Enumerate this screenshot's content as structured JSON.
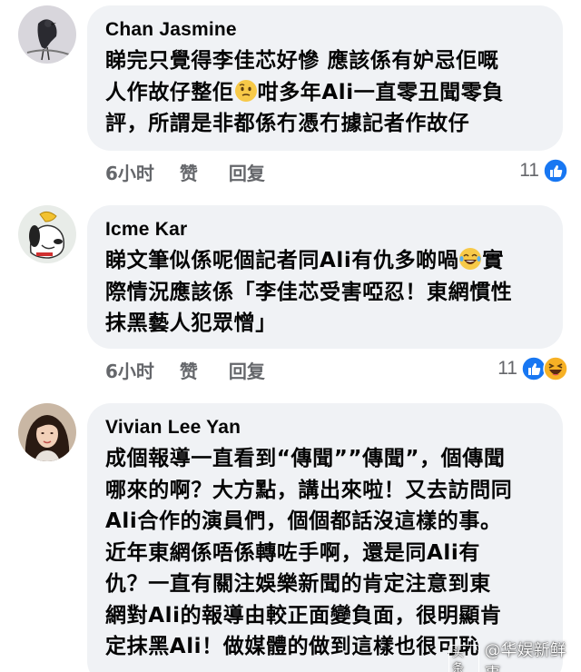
{
  "comments": [
    {
      "author": "Chan Jasmine",
      "lines": [
        "睇完只覺得李佳芯好慘 應該係有妒忌佢嘅",
        "人作故仔整佢",
        "咁多年Ali一直零丑聞零負",
        "評，所謂是非都係冇憑冇據記者作故仔"
      ],
      "time": "6小时",
      "like_label": "赞",
      "reply_label": "回复",
      "reaction_count": "11",
      "avatar": "bird-avatar"
    },
    {
      "author": "Icme Kar",
      "lines": [
        "睇文筆似係呢個記者同Ali有仇多啲喎",
        "實",
        "際情況應該係「李佳芯受害啞忍！東網慣性",
        "抹黑藝人犯眾憎」"
      ],
      "time": "6小时",
      "like_label": "赞",
      "reply_label": "回复",
      "reaction_count": "11",
      "avatar": "snoopy-avatar"
    },
    {
      "author": "Vivian Lee Yan",
      "lines": [
        "成個報導一直看到“傳聞””傳聞”，個傳聞",
        "哪來的啊？大方點，講出來啦！又去訪問同",
        "Ali合作的演員們，個個都話沒這樣的事。",
        "近年東網係唔係轉咗手啊，還是同Ali有",
        "仇？一直有關注娛樂新聞的肯定注意到東",
        "網對Ali的報導由較正面變負面，很明顯肯",
        "定抹黑Ali！做媒體的做到這樣也很可恥"
      ],
      "avatar": "woman-photo-avatar"
    }
  ],
  "watermark": {
    "badge": "头条",
    "text": "@华娱新鲜事"
  },
  "colors": {
    "bubble": "#f0f2f5",
    "meta_text": "#65676b",
    "like_blue": "#1877f2",
    "haha_yellow": "#f7b125"
  }
}
